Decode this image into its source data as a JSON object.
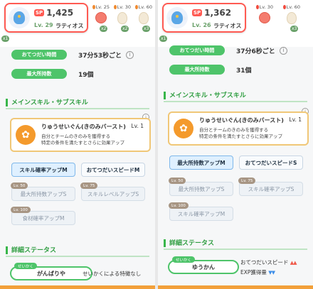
{
  "panels": [
    {
      "poke": {
        "sp_label": "SP",
        "sp": "1,425",
        "level": "Lv. 29",
        "name": "ラティオス"
      },
      "items": [
        {
          "level": "Lv. 25",
          "kind": "berry",
          "count": "x2"
        },
        {
          "level": "Lv. 30",
          "kind": "egg",
          "count": "x2"
        },
        {
          "level": "Lv. 60",
          "kind": "egg",
          "count": "x3"
        }
      ],
      "left_count": "x1",
      "help_label": "おてつだい時間",
      "help_value": "37分53秒ごと",
      "max_label": "最大所持数",
      "max_value": "19個",
      "skill_section": "メインスキル・サブスキル",
      "skill": {
        "name": "りゅうせいぐん(きのみバースト)",
        "level": "Lv. 1",
        "desc": "自分とチームのきのみを獲得する\n特定の条件を満たすとさらに効果アップ"
      },
      "sub_skills": [
        {
          "label": "スキル確率アップM",
          "state": "active",
          "tag": ""
        },
        {
          "label": "おてつだいスピードM",
          "state": "plain",
          "tag": ""
        },
        {
          "label": "最大所持数アップS",
          "state": "locked",
          "tag": "Lv. 50"
        },
        {
          "label": "スキルレベルアップS",
          "state": "locked",
          "tag": "Lv. 75"
        },
        {
          "label": "食材確率アップM",
          "state": "locked",
          "tag": "Lv. 100"
        }
      ],
      "detail_section": "詳細ステータス",
      "nature_tag": "せいかく",
      "nature": "がんばりや",
      "nature_note": "せいかくによる特徴なし"
    },
    {
      "poke": {
        "sp_label": "SP",
        "sp": "1,362",
        "level": "Lv. 26",
        "name": "ラティオス"
      },
      "items": [
        {
          "level": "Lv. 30",
          "kind": "berry",
          "count": ""
        },
        {
          "level": "Lv. 60",
          "kind": "egg",
          "count": "x3"
        }
      ],
      "left_count": "x1",
      "help_label": "おてつだい時間",
      "help_value": "37分6秒ごと",
      "max_label": "最大所持数",
      "max_value": "31個",
      "skill_section": "メインスキル・サブスキル",
      "skill": {
        "name": "りゅうせいぐん(きのみバースト)",
        "level": "Lv. 1",
        "desc": "自分とチームのきのみを獲得する\n特定の条件を満たすとさらに効果アップ"
      },
      "sub_skills": [
        {
          "label": "最大所持数アップM",
          "state": "active",
          "tag": ""
        },
        {
          "label": "おてつだいスピードS",
          "state": "plain",
          "tag": ""
        },
        {
          "label": "最大所持数アップS",
          "state": "locked",
          "tag": "Lv. 50"
        },
        {
          "label": "スキル確率アップS",
          "state": "locked",
          "tag": "Lv. 75"
        },
        {
          "label": "スキル確率アップM",
          "state": "locked",
          "tag": "Lv. 100"
        }
      ],
      "detail_section": "詳細ステータス",
      "nature_tag": "せいかく",
      "nature": "ゆうかん",
      "nature_up_label": "おてつだいスピード",
      "nature_up_marks": "▲▲",
      "nature_down_label": "EXP獲得量",
      "nature_down_marks": "▼▼"
    }
  ],
  "colors": {
    "accent_green": "#4ec46a",
    "card_border": "#ff5a52",
    "skill_border": "#f0c777",
    "bottom_bar": "#f2a03a"
  },
  "icons": {
    "info": "i",
    "berry_burst": "✿"
  }
}
